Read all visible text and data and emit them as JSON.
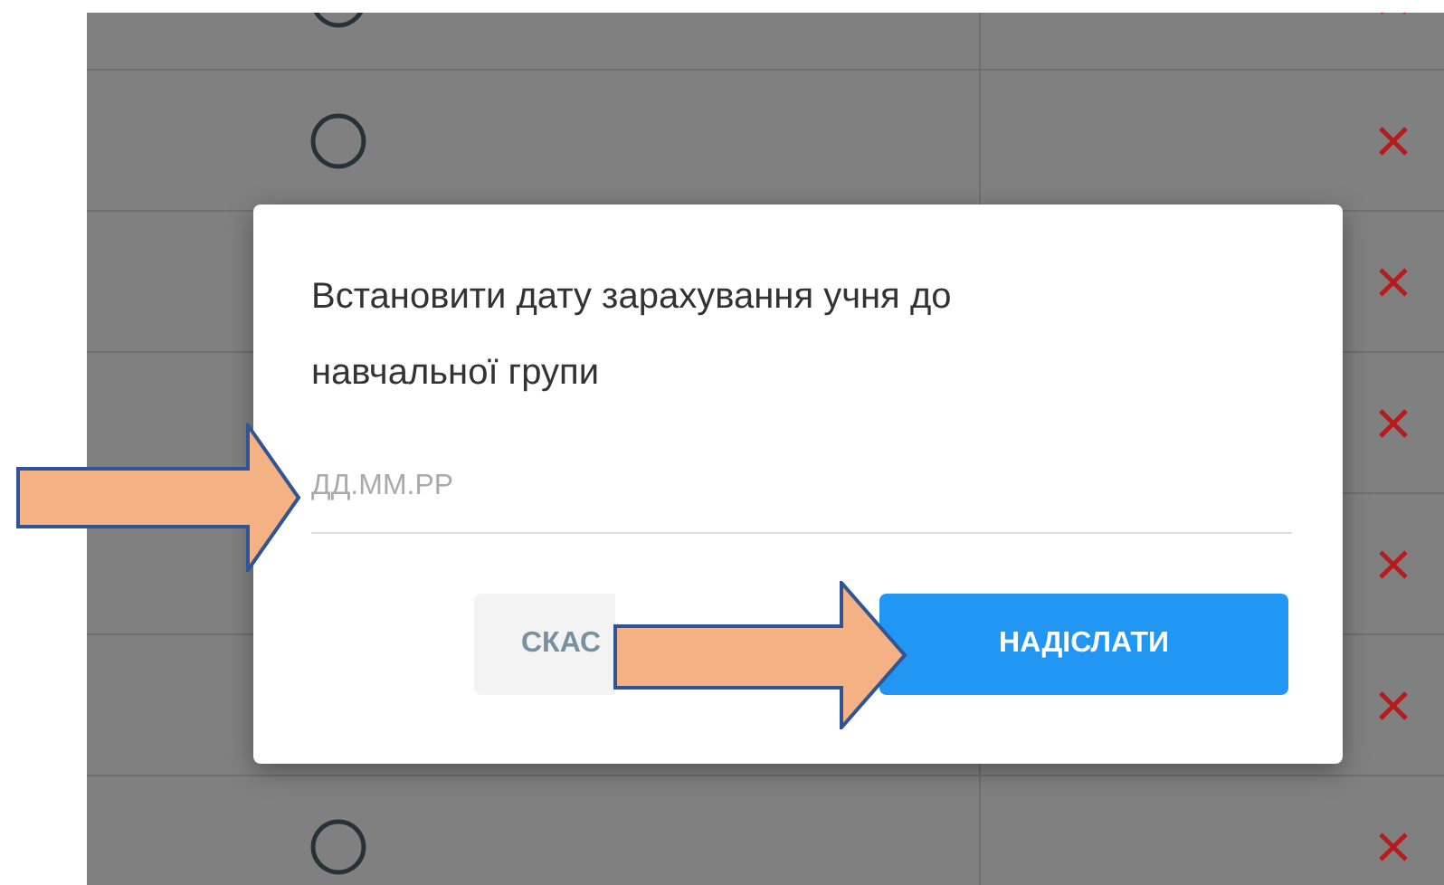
{
  "dialog": {
    "title": "Встановити дату зарахування учня до навчальної групи",
    "date_field": {
      "placeholder": "ДД.ММ.РР"
    },
    "buttons": [
      {
        "kind": "secondary",
        "label": "СКАС"
      },
      {
        "kind": "primary",
        "label": "НАДІСЛАТИ"
      }
    ]
  }
}
